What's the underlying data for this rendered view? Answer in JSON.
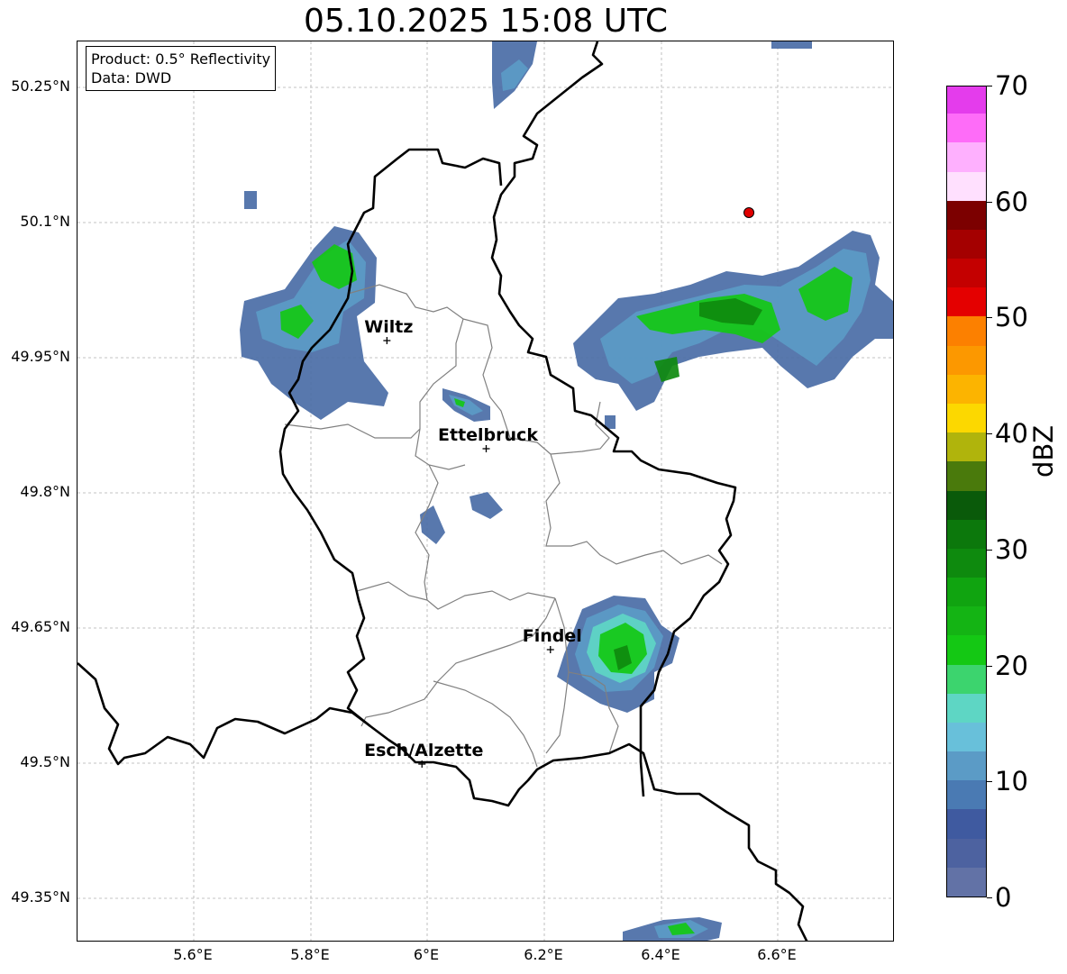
{
  "title": "05.10.2025 15:08 UTC",
  "info_box": {
    "product": "Product: 0.5° Reflectivity",
    "data_source": "Data: DWD"
  },
  "axes": {
    "lat_ticks": [
      "50.25°N",
      "50.1°N",
      "49.95°N",
      "49.8°N",
      "49.65°N",
      "49.5°N",
      "49.35°N"
    ],
    "lon_ticks": [
      "5.6°E",
      "5.8°E",
      "6°E",
      "6.2°E",
      "6.4°E",
      "6.6°E"
    ],
    "lon_range": [
      5.4,
      6.8
    ],
    "lat_range": [
      49.3,
      50.3
    ],
    "gridlines": true
  },
  "cities": [
    {
      "name": "Wiltz",
      "lon": 5.93,
      "lat": 49.968
    },
    {
      "name": "Ettelbruck",
      "lon": 6.1,
      "lat": 49.848
    },
    {
      "name": "Findel",
      "lon": 6.21,
      "lat": 49.625
    },
    {
      "name": "Esch/Alzette",
      "lon": 5.99,
      "lat": 49.498
    }
  ],
  "marker": {
    "lon": 6.55,
    "lat": 50.11,
    "color": "#e00000"
  },
  "colorbar": {
    "label": "dBZ",
    "min": 0,
    "max": 70,
    "ticks": [
      "0",
      "10",
      "20",
      "30",
      "40",
      "50",
      "60",
      "70"
    ],
    "colors": [
      "#6272a6",
      "#4d62a0",
      "#3f5aa0",
      "#4a7ab3",
      "#5b9bc6",
      "#68c0da",
      "#5ed6c4",
      "#3cd46e",
      "#14c814",
      "#14b414",
      "#10a410",
      "#0e8a0e",
      "#0c780c",
      "#0a5a0a",
      "#4a7a0c",
      "#b0b40c",
      "#fcd800",
      "#fcb400",
      "#fc9800",
      "#fc8000",
      "#e40000",
      "#c40000",
      "#a40000",
      "#7c0000",
      "#ffe0fe",
      "#feb0fe",
      "#fe6cf8",
      "#e43cec"
    ]
  },
  "echo_colors": {
    "weak": "#4a6ca6",
    "light": "#5b9bc6",
    "cyan": "#5ed6c4",
    "moderate": "#14c814",
    "strong": "#0e8a0e"
  },
  "border_color": "#000000",
  "canton_color": "#808080"
}
